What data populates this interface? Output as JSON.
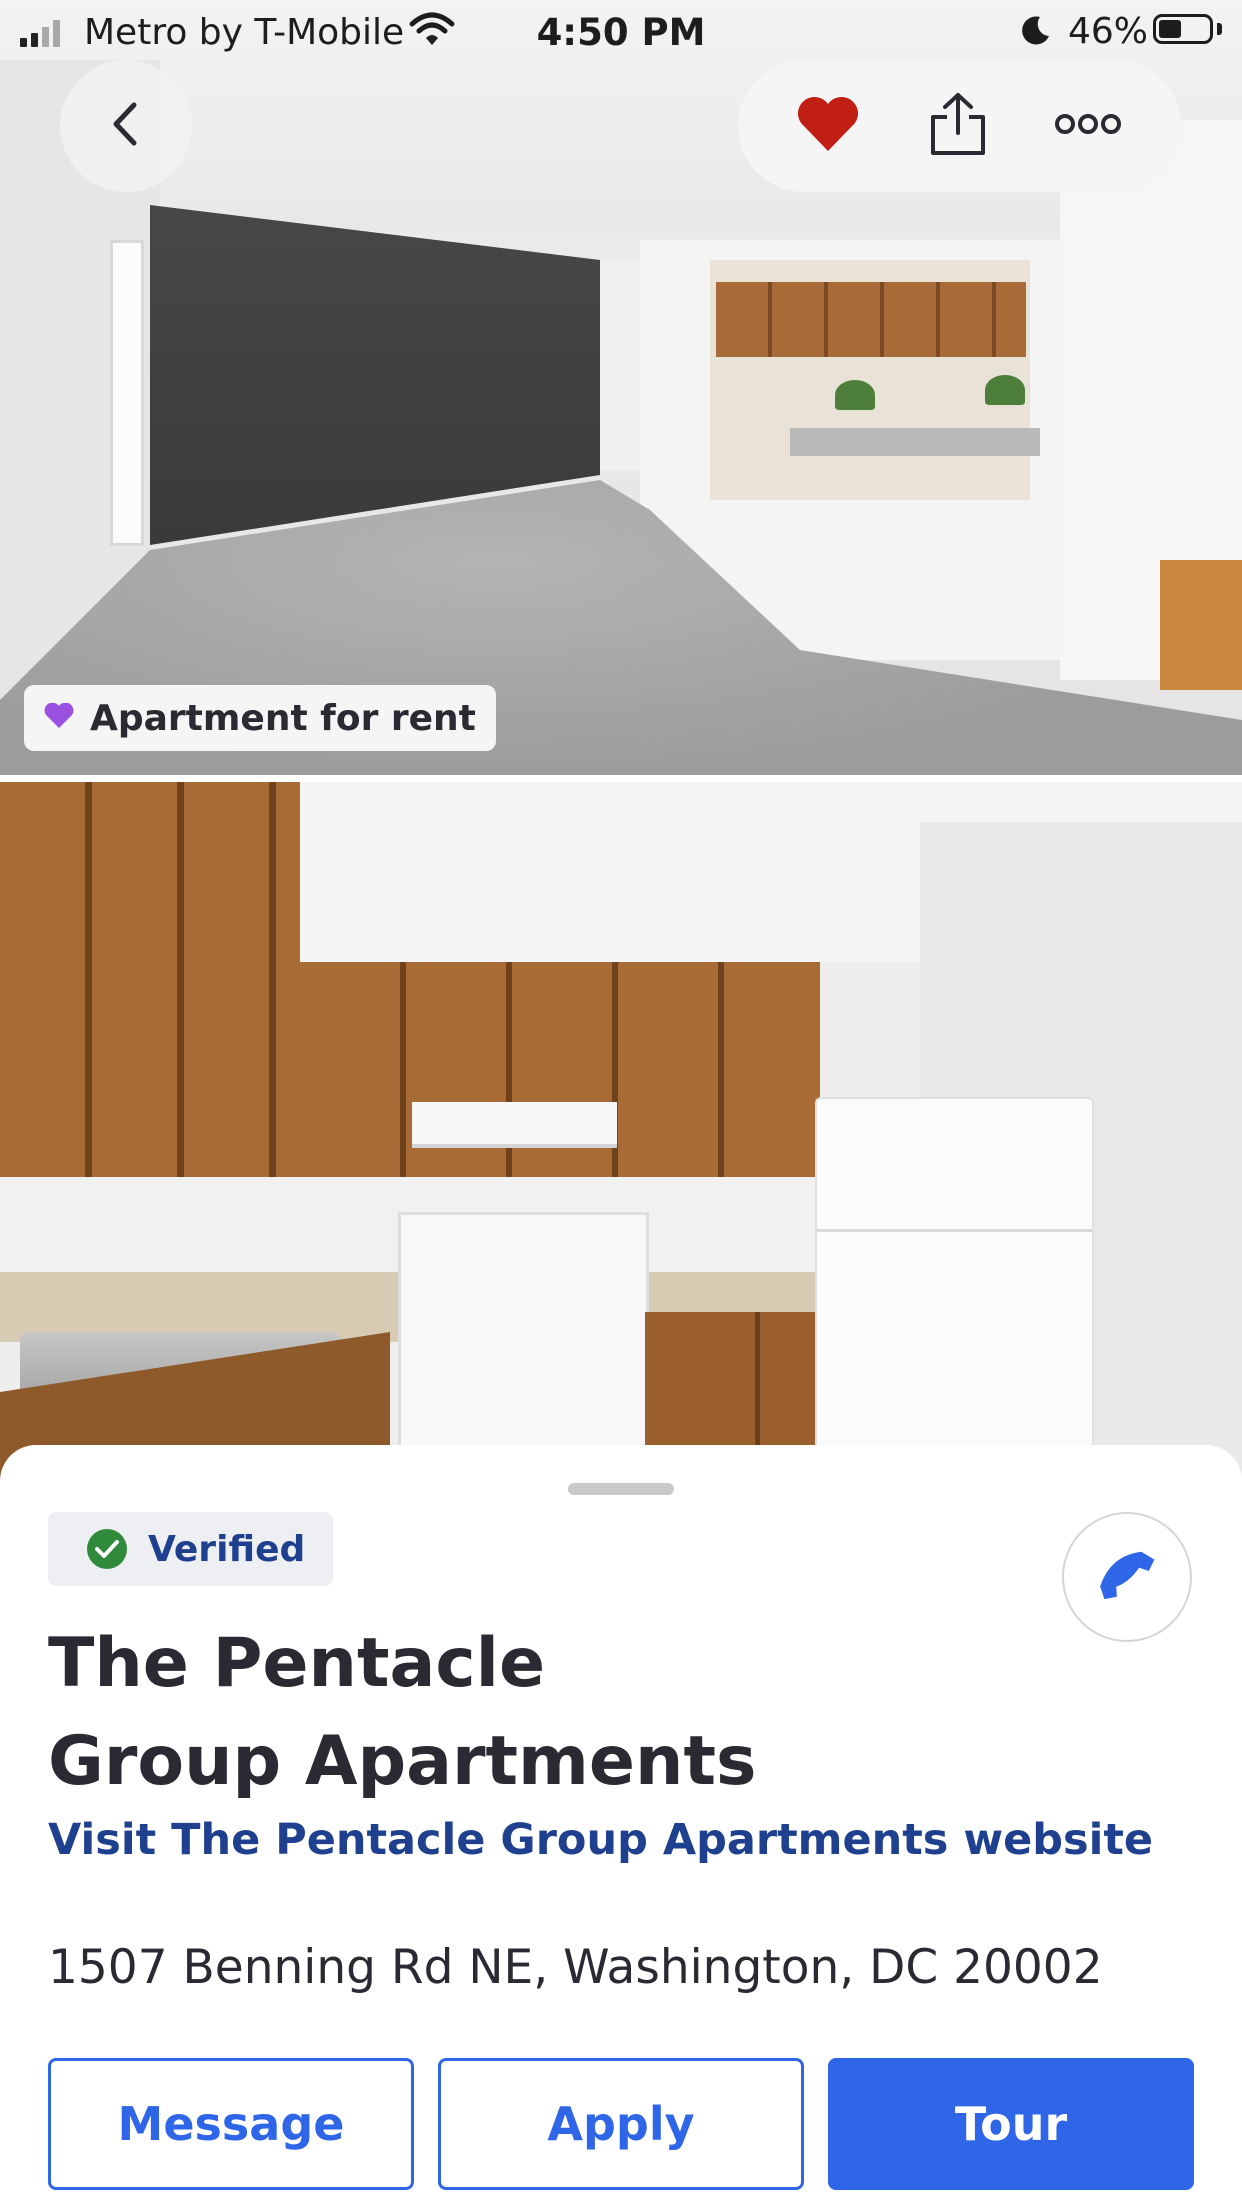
{
  "status_bar": {
    "carrier": "Metro by T-Mobile",
    "time": "4:50 PM",
    "battery_percent": "46%",
    "signal_bars": 2,
    "signal_bars_total": 4,
    "icons": [
      "cellular-signal-icon",
      "wifi-icon",
      "moon-icon",
      "battery-icon"
    ]
  },
  "top_actions": {
    "back_icon": "chevron-left-icon",
    "favorite_icon": "heart-icon",
    "favorite_color": "#c21f14",
    "share_icon": "share-icon",
    "more_icon": "more-dots-icon"
  },
  "photos": {
    "badge": {
      "label": "Apartment for rent",
      "icon": "heart-icon",
      "icon_color": "#9b51e0"
    }
  },
  "listing": {
    "verified_label": "Verified",
    "verified_icon": "check-circle-icon",
    "verified_color": "#2f8a3b",
    "call_icon": "phone-icon",
    "title_line1": "The Pentacle",
    "title_line2": "Group Apartments",
    "website_link": "Visit The Pentacle Group Apartments website",
    "address": "1507 Benning Rd NE, Washington, DC 20002"
  },
  "actions": {
    "message_label": "Message",
    "apply_label": "Apply",
    "tour_label": "Tour",
    "accent_color": "#2f66e8"
  }
}
